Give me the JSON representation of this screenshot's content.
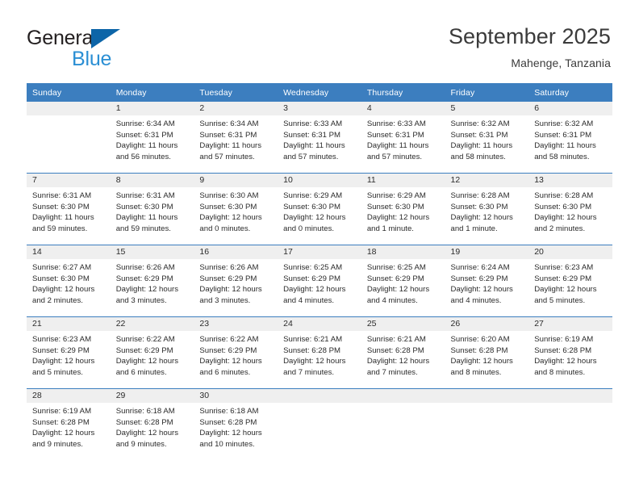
{
  "brand": {
    "name_part1": "General",
    "name_part2": "Blue"
  },
  "header": {
    "title": "September 2025",
    "subtitle": "Mahenge, Tanzania"
  },
  "weekday_headers": [
    "Sunday",
    "Monday",
    "Tuesday",
    "Wednesday",
    "Thursday",
    "Friday",
    "Saturday"
  ],
  "colors": {
    "header_blue": "#3c7ebf",
    "daynum_gray": "#efefef",
    "brand_blue": "#2b8fd4",
    "logo_triangle": "#0d65a8"
  },
  "labels": {
    "sunrise_prefix": "Sunrise:",
    "sunset_prefix": "Sunset:",
    "daylight_prefix": "Daylight:"
  },
  "weeks": [
    [
      {
        "day": "",
        "sunrise": "",
        "sunset": "",
        "daylight_line1": "",
        "daylight_line2": "",
        "blank": true
      },
      {
        "day": "1",
        "sunrise": "Sunrise: 6:34 AM",
        "sunset": "Sunset: 6:31 PM",
        "daylight_line1": "Daylight: 11 hours",
        "daylight_line2": "and 56 minutes."
      },
      {
        "day": "2",
        "sunrise": "Sunrise: 6:34 AM",
        "sunset": "Sunset: 6:31 PM",
        "daylight_line1": "Daylight: 11 hours",
        "daylight_line2": "and 57 minutes."
      },
      {
        "day": "3",
        "sunrise": "Sunrise: 6:33 AM",
        "sunset": "Sunset: 6:31 PM",
        "daylight_line1": "Daylight: 11 hours",
        "daylight_line2": "and 57 minutes."
      },
      {
        "day": "4",
        "sunrise": "Sunrise: 6:33 AM",
        "sunset": "Sunset: 6:31 PM",
        "daylight_line1": "Daylight: 11 hours",
        "daylight_line2": "and 57 minutes."
      },
      {
        "day": "5",
        "sunrise": "Sunrise: 6:32 AM",
        "sunset": "Sunset: 6:31 PM",
        "daylight_line1": "Daylight: 11 hours",
        "daylight_line2": "and 58 minutes."
      },
      {
        "day": "6",
        "sunrise": "Sunrise: 6:32 AM",
        "sunset": "Sunset: 6:31 PM",
        "daylight_line1": "Daylight: 11 hours",
        "daylight_line2": "and 58 minutes."
      }
    ],
    [
      {
        "day": "7",
        "sunrise": "Sunrise: 6:31 AM",
        "sunset": "Sunset: 6:30 PM",
        "daylight_line1": "Daylight: 11 hours",
        "daylight_line2": "and 59 minutes."
      },
      {
        "day": "8",
        "sunrise": "Sunrise: 6:31 AM",
        "sunset": "Sunset: 6:30 PM",
        "daylight_line1": "Daylight: 11 hours",
        "daylight_line2": "and 59 minutes."
      },
      {
        "day": "9",
        "sunrise": "Sunrise: 6:30 AM",
        "sunset": "Sunset: 6:30 PM",
        "daylight_line1": "Daylight: 12 hours",
        "daylight_line2": "and 0 minutes."
      },
      {
        "day": "10",
        "sunrise": "Sunrise: 6:29 AM",
        "sunset": "Sunset: 6:30 PM",
        "daylight_line1": "Daylight: 12 hours",
        "daylight_line2": "and 0 minutes."
      },
      {
        "day": "11",
        "sunrise": "Sunrise: 6:29 AM",
        "sunset": "Sunset: 6:30 PM",
        "daylight_line1": "Daylight: 12 hours",
        "daylight_line2": "and 1 minute."
      },
      {
        "day": "12",
        "sunrise": "Sunrise: 6:28 AM",
        "sunset": "Sunset: 6:30 PM",
        "daylight_line1": "Daylight: 12 hours",
        "daylight_line2": "and 1 minute."
      },
      {
        "day": "13",
        "sunrise": "Sunrise: 6:28 AM",
        "sunset": "Sunset: 6:30 PM",
        "daylight_line1": "Daylight: 12 hours",
        "daylight_line2": "and 2 minutes."
      }
    ],
    [
      {
        "day": "14",
        "sunrise": "Sunrise: 6:27 AM",
        "sunset": "Sunset: 6:30 PM",
        "daylight_line1": "Daylight: 12 hours",
        "daylight_line2": "and 2 minutes."
      },
      {
        "day": "15",
        "sunrise": "Sunrise: 6:26 AM",
        "sunset": "Sunset: 6:29 PM",
        "daylight_line1": "Daylight: 12 hours",
        "daylight_line2": "and 3 minutes."
      },
      {
        "day": "16",
        "sunrise": "Sunrise: 6:26 AM",
        "sunset": "Sunset: 6:29 PM",
        "daylight_line1": "Daylight: 12 hours",
        "daylight_line2": "and 3 minutes."
      },
      {
        "day": "17",
        "sunrise": "Sunrise: 6:25 AM",
        "sunset": "Sunset: 6:29 PM",
        "daylight_line1": "Daylight: 12 hours",
        "daylight_line2": "and 4 minutes."
      },
      {
        "day": "18",
        "sunrise": "Sunrise: 6:25 AM",
        "sunset": "Sunset: 6:29 PM",
        "daylight_line1": "Daylight: 12 hours",
        "daylight_line2": "and 4 minutes."
      },
      {
        "day": "19",
        "sunrise": "Sunrise: 6:24 AM",
        "sunset": "Sunset: 6:29 PM",
        "daylight_line1": "Daylight: 12 hours",
        "daylight_line2": "and 4 minutes."
      },
      {
        "day": "20",
        "sunrise": "Sunrise: 6:23 AM",
        "sunset": "Sunset: 6:29 PM",
        "daylight_line1": "Daylight: 12 hours",
        "daylight_line2": "and 5 minutes."
      }
    ],
    [
      {
        "day": "21",
        "sunrise": "Sunrise: 6:23 AM",
        "sunset": "Sunset: 6:29 PM",
        "daylight_line1": "Daylight: 12 hours",
        "daylight_line2": "and 5 minutes."
      },
      {
        "day": "22",
        "sunrise": "Sunrise: 6:22 AM",
        "sunset": "Sunset: 6:29 PM",
        "daylight_line1": "Daylight: 12 hours",
        "daylight_line2": "and 6 minutes."
      },
      {
        "day": "23",
        "sunrise": "Sunrise: 6:22 AM",
        "sunset": "Sunset: 6:29 PM",
        "daylight_line1": "Daylight: 12 hours",
        "daylight_line2": "and 6 minutes."
      },
      {
        "day": "24",
        "sunrise": "Sunrise: 6:21 AM",
        "sunset": "Sunset: 6:28 PM",
        "daylight_line1": "Daylight: 12 hours",
        "daylight_line2": "and 7 minutes."
      },
      {
        "day": "25",
        "sunrise": "Sunrise: 6:21 AM",
        "sunset": "Sunset: 6:28 PM",
        "daylight_line1": "Daylight: 12 hours",
        "daylight_line2": "and 7 minutes."
      },
      {
        "day": "26",
        "sunrise": "Sunrise: 6:20 AM",
        "sunset": "Sunset: 6:28 PM",
        "daylight_line1": "Daylight: 12 hours",
        "daylight_line2": "and 8 minutes."
      },
      {
        "day": "27",
        "sunrise": "Sunrise: 6:19 AM",
        "sunset": "Sunset: 6:28 PM",
        "daylight_line1": "Daylight: 12 hours",
        "daylight_line2": "and 8 minutes."
      }
    ],
    [
      {
        "day": "28",
        "sunrise": "Sunrise: 6:19 AM",
        "sunset": "Sunset: 6:28 PM",
        "daylight_line1": "Daylight: 12 hours",
        "daylight_line2": "and 9 minutes."
      },
      {
        "day": "29",
        "sunrise": "Sunrise: 6:18 AM",
        "sunset": "Sunset: 6:28 PM",
        "daylight_line1": "Daylight: 12 hours",
        "daylight_line2": "and 9 minutes."
      },
      {
        "day": "30",
        "sunrise": "Sunrise: 6:18 AM",
        "sunset": "Sunset: 6:28 PM",
        "daylight_line1": "Daylight: 12 hours",
        "daylight_line2": "and 10 minutes."
      },
      {
        "day": "",
        "sunrise": "",
        "sunset": "",
        "daylight_line1": "",
        "daylight_line2": "",
        "blank": true
      },
      {
        "day": "",
        "sunrise": "",
        "sunset": "",
        "daylight_line1": "",
        "daylight_line2": "",
        "blank": true
      },
      {
        "day": "",
        "sunrise": "",
        "sunset": "",
        "daylight_line1": "",
        "daylight_line2": "",
        "blank": true
      },
      {
        "day": "",
        "sunrise": "",
        "sunset": "",
        "daylight_line1": "",
        "daylight_line2": "",
        "blank": true
      }
    ]
  ]
}
